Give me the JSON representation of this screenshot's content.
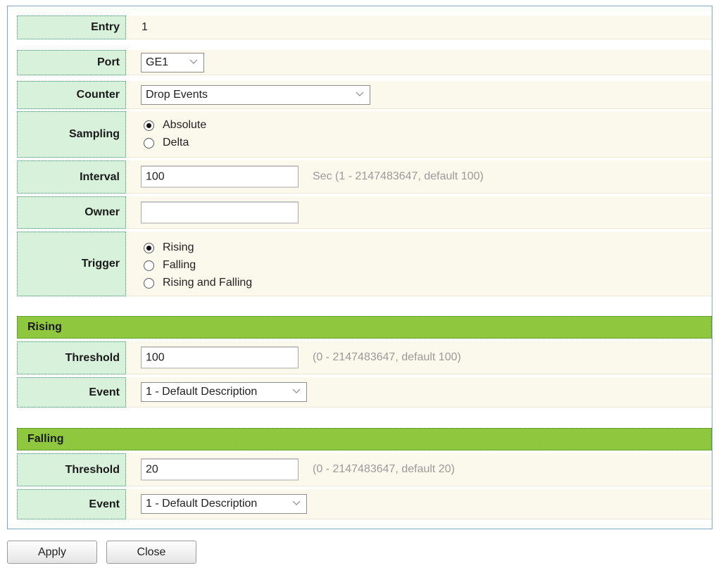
{
  "entry": {
    "label": "Entry",
    "value": "1"
  },
  "port": {
    "label": "Port",
    "selected": "GE1"
  },
  "counter": {
    "label": "Counter",
    "selected": "Drop Events"
  },
  "sampling": {
    "label": "Sampling",
    "options": [
      {
        "label": "Absolute",
        "checked": true
      },
      {
        "label": "Delta",
        "checked": false
      }
    ]
  },
  "interval": {
    "label": "Interval",
    "value": "100",
    "hint": "Sec (1 - 2147483647, default 100)"
  },
  "owner": {
    "label": "Owner",
    "value": ""
  },
  "trigger": {
    "label": "Trigger",
    "options": [
      {
        "label": "Rising",
        "checked": true
      },
      {
        "label": "Falling",
        "checked": false
      },
      {
        "label": "Rising and Falling",
        "checked": false
      }
    ]
  },
  "rising": {
    "title": "Rising",
    "threshold_label": "Threshold",
    "threshold_value": "100",
    "threshold_hint": "(0 - 2147483647, default 100)",
    "event_label": "Event",
    "event_selected": "1 - Default Description"
  },
  "falling": {
    "title": "Falling",
    "threshold_label": "Threshold",
    "threshold_value": "20",
    "threshold_hint": "(0 - 2147483647, default 20)",
    "event_label": "Event",
    "event_selected": "1 - Default Description"
  },
  "buttons": {
    "apply": "Apply",
    "close": "Close"
  },
  "colors": {
    "label_bg": "#d8f1da",
    "section_bg": "#8fc73e",
    "value_bg": "#fbf8ec",
    "panel_border": "#7fa7c9"
  }
}
